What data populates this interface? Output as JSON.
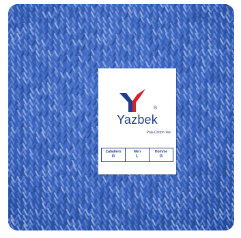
{
  "photo": {
    "subject": "blue-knit-fabric",
    "fabric_color": "#3a63b8"
  },
  "tag": {
    "logo_letter": "Y",
    "logo_colors": {
      "navy": "#1f3f8a",
      "red": "#d81f2a"
    },
    "registered_mark": "®",
    "brand": "Yazbek",
    "subtitle": "Poly-Cotton Tee",
    "sizes": [
      {
        "name": "Caballero",
        "value": "G"
      },
      {
        "name": "Men",
        "value": "L"
      },
      {
        "name": "Homme",
        "value": "G"
      }
    ]
  }
}
